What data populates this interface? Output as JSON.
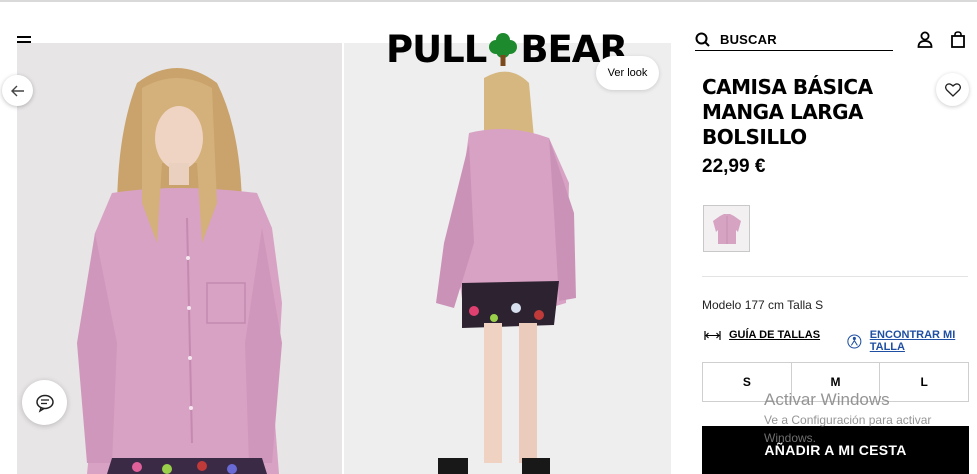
{
  "header": {
    "logo_left": "PULL",
    "logo_right": "BEAR",
    "search_label": "BUSCAR"
  },
  "gallery": {
    "ver_look_label": "Ver look"
  },
  "product": {
    "title_lines": [
      "CAMISA BÁSICA",
      "MANGA LARGA",
      "BOLSILLO"
    ],
    "price": "22,99 €",
    "model_info": "Modelo 177 cm Talla S",
    "size_guide_label": "GUÍA DE TALLAS",
    "find_size_label": "ENCONTRAR MI TALLA",
    "sizes": [
      "S",
      "M",
      "L"
    ],
    "add_to_cart_label": "AÑADIR A MI CESTA",
    "swatch_color": "#d6a3c2"
  },
  "watermark": {
    "title": "Activar Windows",
    "subtitle": "Ve a Configuración para activar Windows."
  },
  "icons": {
    "menu": "menu-icon",
    "search": "search-icon",
    "user": "user-icon",
    "bag": "bag-icon",
    "arrow_left": "arrow-left-icon",
    "heart": "heart-icon",
    "chat": "chat-icon",
    "ruler": "ruler-icon",
    "person_size": "person-size-icon"
  },
  "colors": {
    "accent_link": "#1f4fa3",
    "cart_button": "#000000",
    "shirt": "#d9a3c6",
    "logo_tree": "#1e8a2e"
  }
}
